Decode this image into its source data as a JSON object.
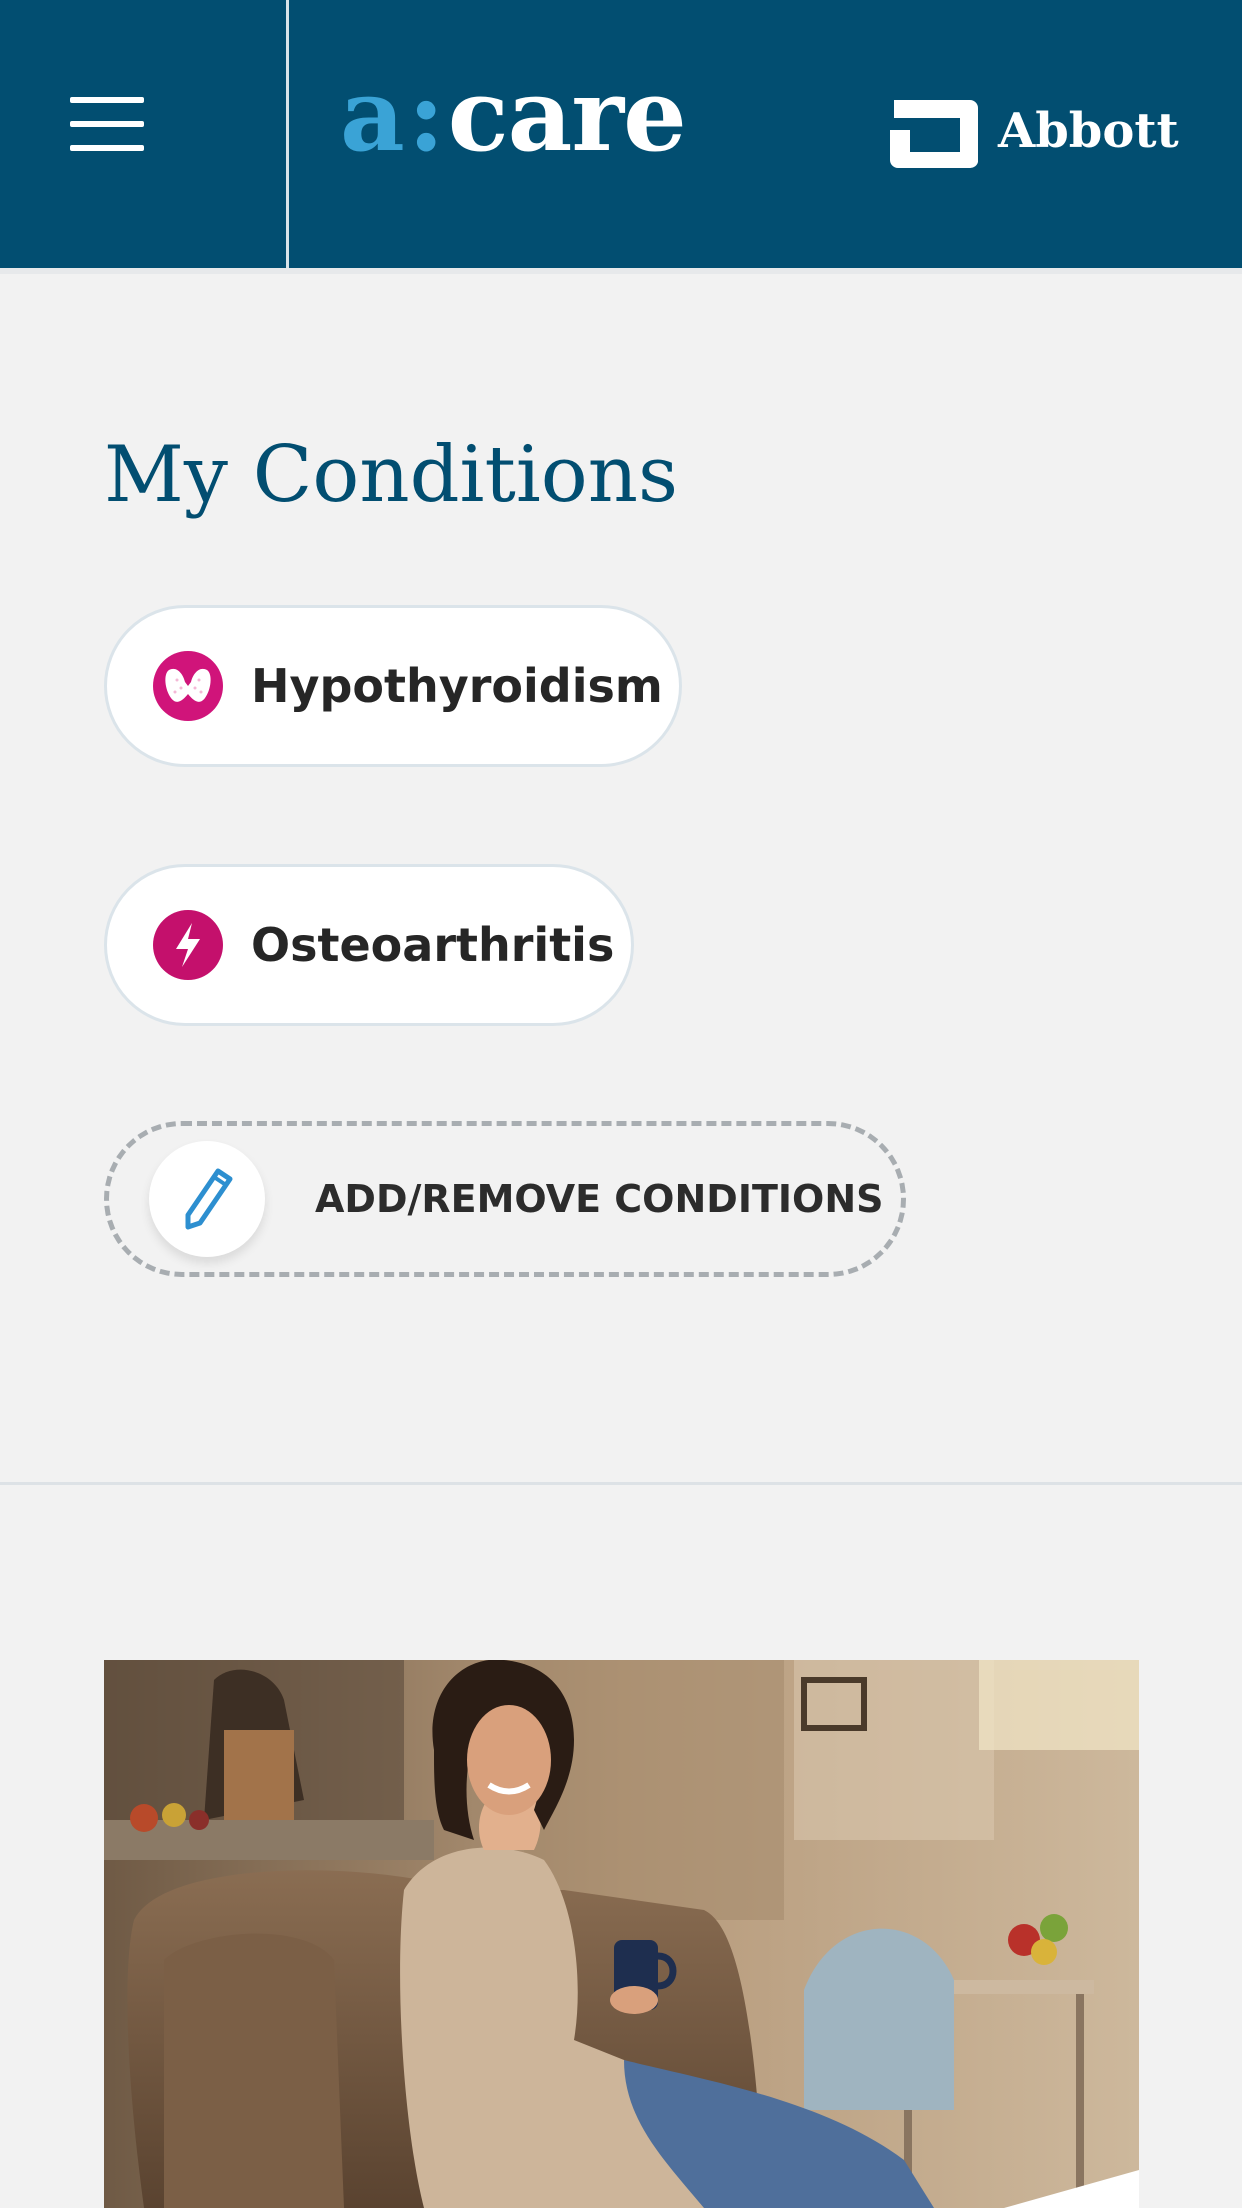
{
  "header": {
    "menu_icon": "hamburger-menu-icon",
    "brand_logo": {
      "letter_a": "a",
      "colon": ":",
      "rest": "care"
    },
    "partner_logo": {
      "text": "Abbott",
      "icon": "abbott-logo-icon"
    }
  },
  "main": {
    "title": "My Conditions",
    "conditions": [
      {
        "label": "Hypothyroidism",
        "icon": "thyroid-icon",
        "icon_color": "#d0147a"
      },
      {
        "label": "Osteoarthritis",
        "icon": "lightning-bolt-icon",
        "icon_color": "#c4106c"
      }
    ],
    "add_remove": {
      "label": "ADD/REMOVE CONDITIONS",
      "icon": "pencil-icon"
    }
  },
  "banner": {
    "image": "woman-with-mug-on-sofa-photo"
  },
  "colors": {
    "header_bg": "#024e71",
    "accent_blue": "#3aa3d6",
    "title_blue": "#024e71",
    "condition_icon": "#d0147a",
    "page_bg": "#f2f2f2"
  }
}
